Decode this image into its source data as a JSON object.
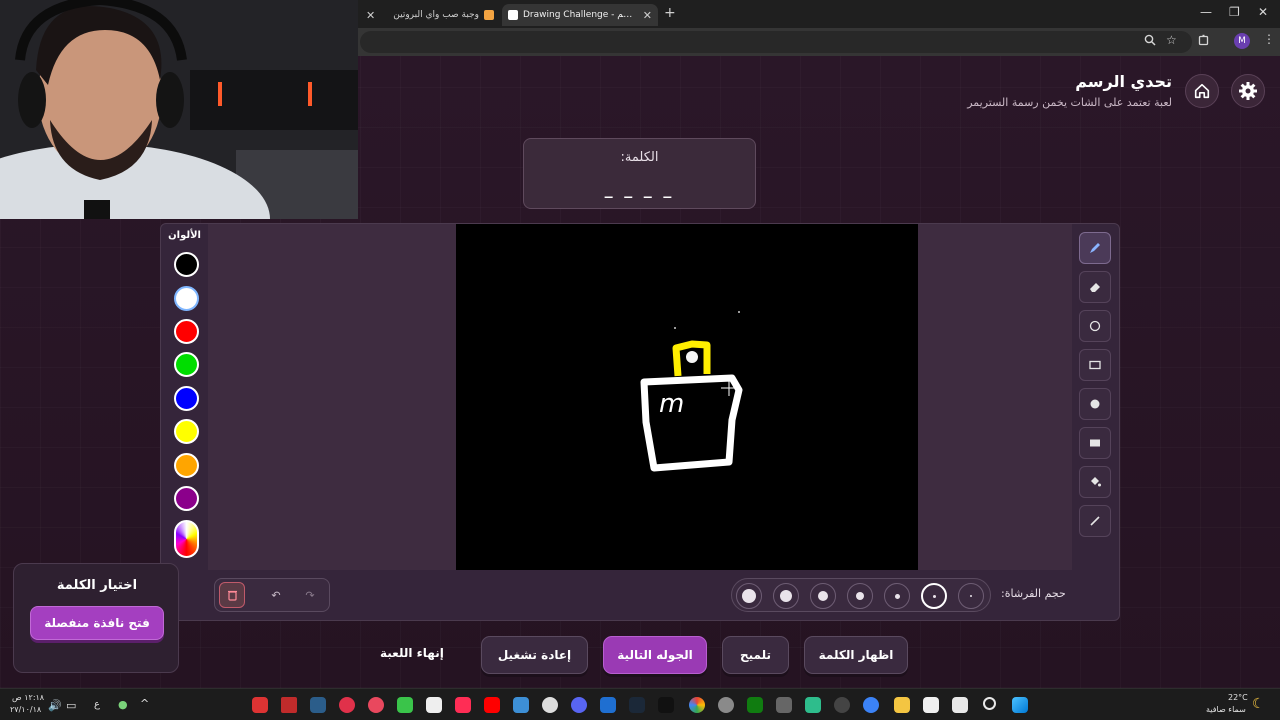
{
  "browser": {
    "tabs": [
      {
        "title": "وجبة صب واي البروتين",
        "active": false
      },
      {
        "title": "Drawing Challenge - تحدي الرسم",
        "active": true
      }
    ],
    "profile_initial": "M"
  },
  "header": {
    "title": "تحدي الرسم",
    "subtitle": "لعبة تعتمد على الشات يخمن رسمة الستريمر"
  },
  "word_box": {
    "label": "الكلمة:",
    "blanks": "_ _ _ _"
  },
  "colors": {
    "title": "الألوان",
    "swatches": [
      "#000000",
      "#ffffff",
      "#ff0000",
      "#00dd00",
      "#0000ff",
      "#ffff00",
      "#ffa500",
      "#8b008b"
    ]
  },
  "drawing": {
    "background": "#000000",
    "letter": "m"
  },
  "tools": [
    "brush-icon",
    "eraser-icon",
    "circle-outline-icon",
    "rectangle-outline-icon",
    "circle-filled-icon",
    "rectangle-filled-icon",
    "fill-bucket-icon",
    "line-icon"
  ],
  "brush": {
    "label": "حجم الفرشاة:",
    "selected_size_index": 1
  },
  "game_buttons": {
    "show_word": "اظهار الكلمة",
    "hint": "تلميح",
    "next_round": "الجوله التالية",
    "restart": "إعادة تشغيل",
    "end_game": "إنهاء اللعبة"
  },
  "word_pick": {
    "title": "اختيار الكلمة",
    "button": "فتح نافذة منفصلة"
  },
  "taskbar": {
    "weather_temp": "22°C",
    "weather_desc": "سماء صافية",
    "time": "١٢:١٨ ص",
    "date": "٢٧/١٠/١٨",
    "lang": "ع"
  }
}
